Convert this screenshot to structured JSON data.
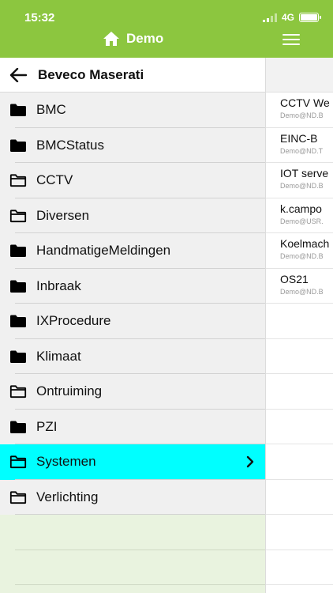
{
  "status": {
    "time": "15:32",
    "network": "4G"
  },
  "app": {
    "title": "Demo"
  },
  "drawer": {
    "title": "Beveco Maserati",
    "folders": [
      {
        "label": "BMC",
        "filled": true
      },
      {
        "label": "BMCStatus",
        "filled": true
      },
      {
        "label": "CCTV",
        "filled": false
      },
      {
        "label": "Diversen",
        "filled": false
      },
      {
        "label": "HandmatigeMeldingen",
        "filled": true
      },
      {
        "label": "Inbraak",
        "filled": true
      },
      {
        "label": "IXProcedure",
        "filled": true
      },
      {
        "label": "Klimaat",
        "filled": true
      },
      {
        "label": "Ontruiming",
        "filled": false
      },
      {
        "label": "PZI",
        "filled": true
      },
      {
        "label": "Systemen",
        "filled": false,
        "selected": true
      },
      {
        "label": "Verlichting",
        "filled": false
      }
    ]
  },
  "background_list": [
    {
      "title": "CCTV We",
      "subtitle": "Demo@ND.B"
    },
    {
      "title": "EINC-B",
      "subtitle": "Demo@ND.T"
    },
    {
      "title": "IOT serve",
      "subtitle": "Demo@ND.B"
    },
    {
      "title": "k.campo",
      "subtitle": "Demo@USR."
    },
    {
      "title": "Koelmach",
      "subtitle": "Demo@ND.B"
    },
    {
      "title": "OS21",
      "subtitle": "Demo@ND.B"
    }
  ],
  "colors": {
    "brand": "#8cc63f",
    "selected": "#00ffff",
    "drawer_bg": "#e9f3df"
  }
}
